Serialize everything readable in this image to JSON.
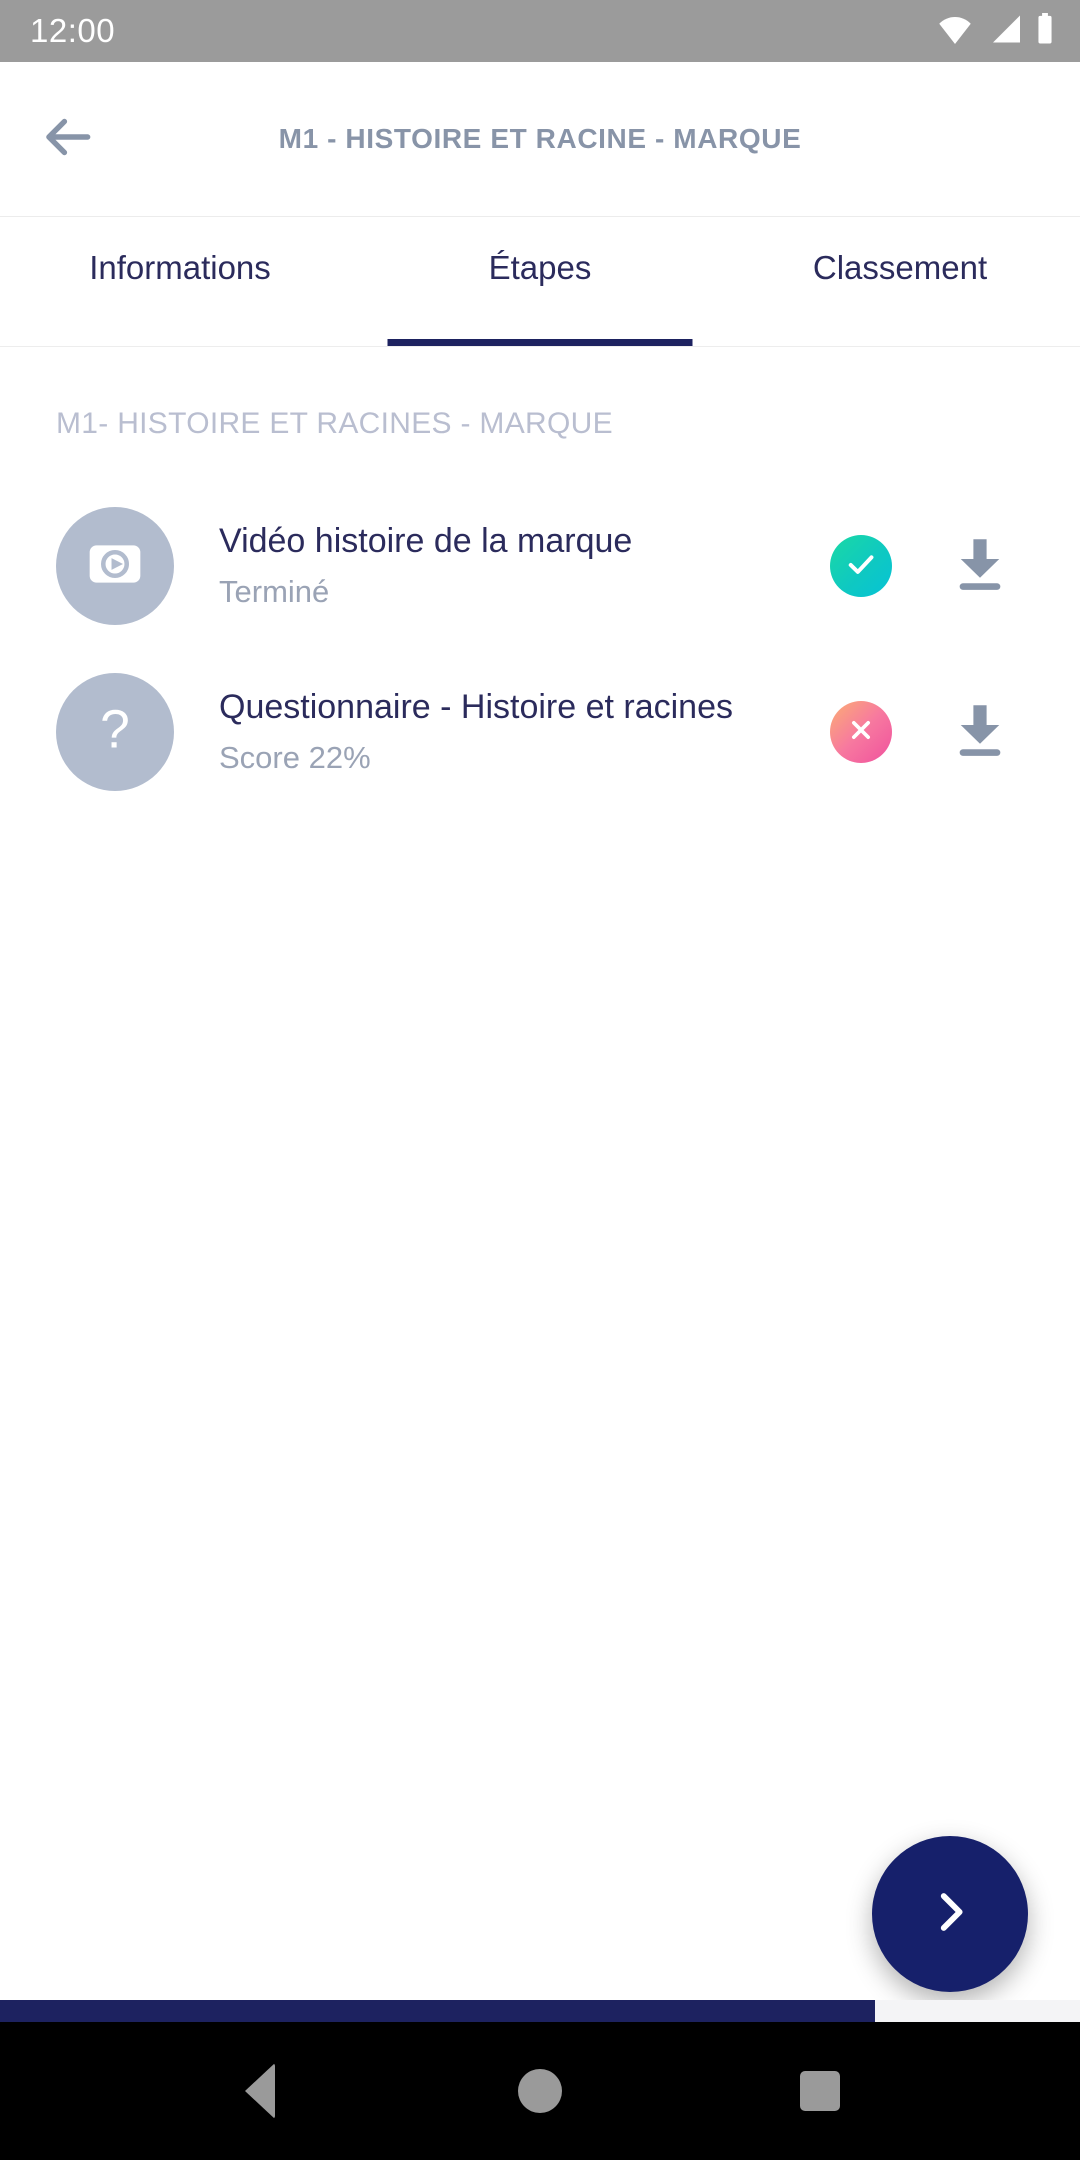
{
  "status_bar": {
    "time": "12:00",
    "icons": [
      "wifi-icon",
      "cellular-signal-icon",
      "battery-icon"
    ]
  },
  "app_bar": {
    "back_icon": "arrow-left-icon",
    "title": "M1 - HISTOIRE ET RACINE - MARQUE"
  },
  "tabs": [
    {
      "label": "Informations",
      "active": false
    },
    {
      "label": "Étapes",
      "active": true
    },
    {
      "label": "Classement",
      "active": false
    }
  ],
  "section": {
    "title": "M1- HISTOIRE ET RACINES - MARQUE"
  },
  "steps": [
    {
      "icon": "video-play-icon",
      "title": "Vidéo histoire de la marque",
      "subtitle": "Terminé",
      "status": "completed",
      "status_icon": "check-icon",
      "action_icon": "download-icon"
    },
    {
      "icon": "question-mark-icon",
      "title": "Questionnaire - Histoire et racines",
      "subtitle": "Score 22%",
      "status": "failed",
      "status_icon": "close-x-icon",
      "action_icon": "download-icon"
    }
  ],
  "fab": {
    "icon": "chevron-right-icon"
  },
  "bottom_progress": {
    "percent": 81
  },
  "nav_bar": {
    "back": "triangle-back-icon",
    "home": "circle-home-icon",
    "recents": "square-recents-icon"
  },
  "colors": {
    "navy": "#1d2260",
    "fab": "#16206b",
    "title_gray": "#8894a8",
    "muted": "#b9bed0",
    "avatar": "#b2bcce",
    "success": "#0fc9c1",
    "error": "#f0519e",
    "status_bar_bg": "#9b9b9b"
  }
}
